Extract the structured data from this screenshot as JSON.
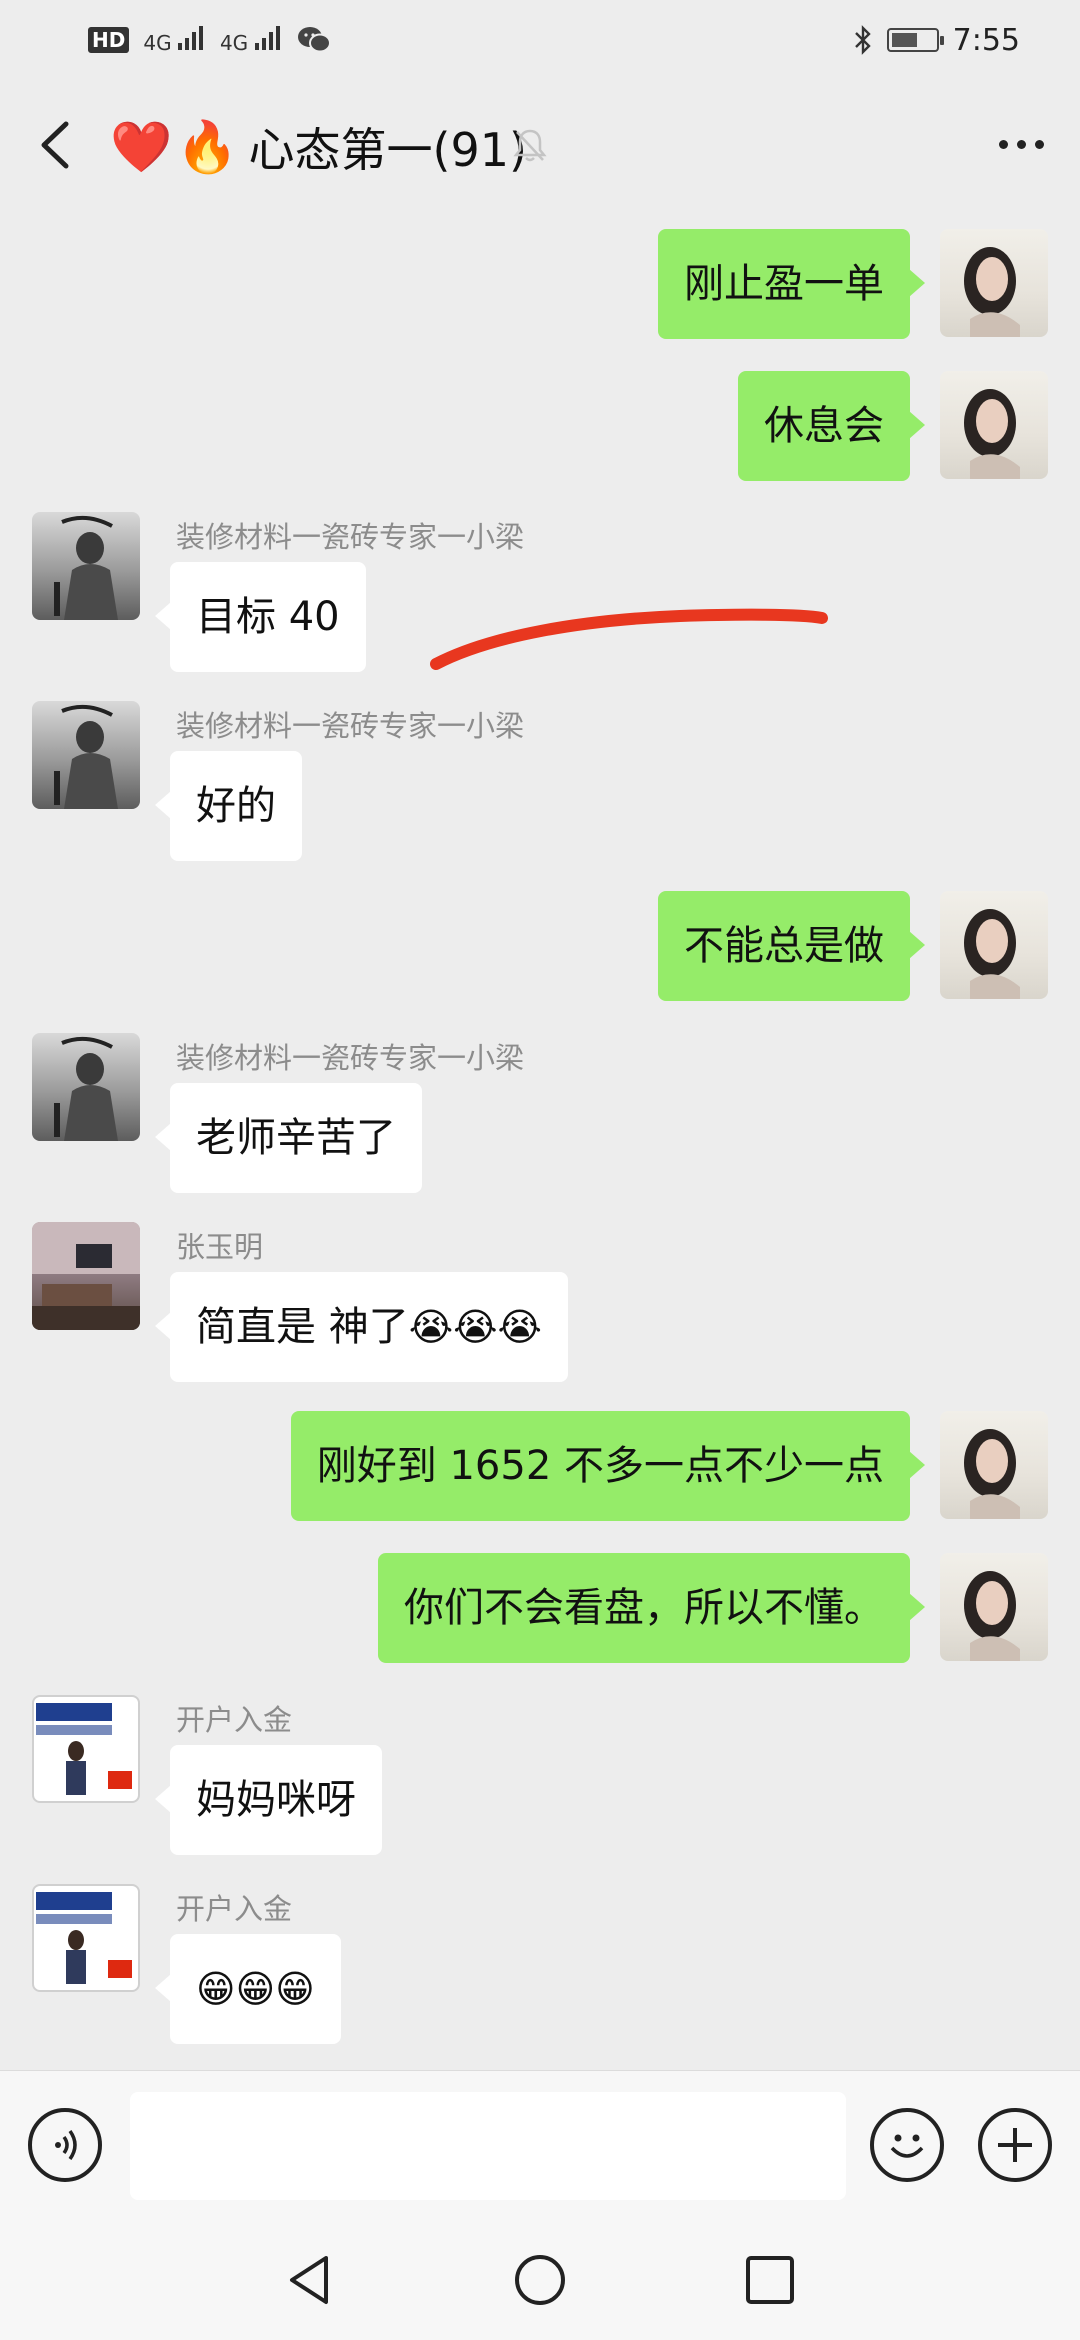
{
  "status_bar": {
    "hd_badge": "HD",
    "sim1_network": "4G",
    "sim2_network": "4G",
    "time": "7:55",
    "battery_level": 0.6
  },
  "header": {
    "back_icon": "chevron-left-icon",
    "title_emoji_heart": "❤️",
    "title_emoji_fire": "🔥",
    "title": "心态第一(91)",
    "mute_icon": "bell-off-icon",
    "more_icon": "more-dots-icon"
  },
  "messages": [
    {
      "side": "right",
      "text": "刚止盈一单"
    },
    {
      "side": "right",
      "text": "休息会"
    },
    {
      "side": "left",
      "sender": "装修材料一瓷砖专家一小梁",
      "text": "目标 40"
    },
    {
      "side": "left",
      "sender": "装修材料一瓷砖专家一小梁",
      "text": "好的"
    },
    {
      "side": "right",
      "text": "不能总是做"
    },
    {
      "side": "left",
      "sender": "装修材料一瓷砖专家一小梁",
      "text": "老师辛苦了"
    },
    {
      "side": "left",
      "sender": "张玉明",
      "text": "简直是 神了",
      "emojis": "😭😭😭"
    },
    {
      "side": "right",
      "text": "刚好到 1652 不多一点不少一点"
    },
    {
      "side": "right",
      "text": "你们不会看盘，所以不懂。"
    },
    {
      "side": "left",
      "sender": "开户入金",
      "text": "妈妈咪呀"
    },
    {
      "side": "left",
      "sender": "开户入金",
      "emojis": "😁😁😁"
    }
  ],
  "annotation": {
    "color": "#e8371f",
    "description": "red-underline-stroke"
  },
  "input_bar": {
    "voice_icon": "voice-icon",
    "input_value": "",
    "emoji_icon": "emoji-icon",
    "plus_icon": "plus-icon"
  },
  "nav_bar": {
    "back_icon": "nav-back-icon",
    "home_icon": "nav-home-icon",
    "recents_icon": "nav-recents-icon"
  },
  "colors": {
    "chat_background": "#ededed",
    "self_bubble": "#95ec69",
    "other_bubble": "#ffffff",
    "sender_name": "#8c8c8c"
  }
}
